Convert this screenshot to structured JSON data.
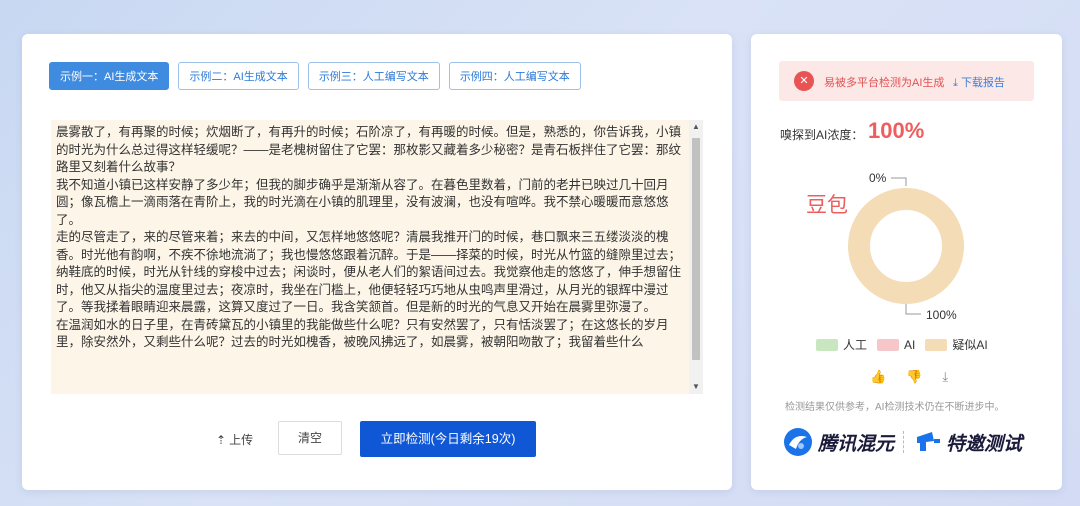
{
  "tabs": [
    {
      "label": "示例一：AI生成文本",
      "active": true
    },
    {
      "label": "示例二：AI生成文本",
      "active": false
    },
    {
      "label": "示例三：人工编写文本",
      "active": false
    },
    {
      "label": "示例四：人工编写文本",
      "active": false
    }
  ],
  "text_paragraphs": [
    "晨雾散了，有再聚的时候；炊烟断了，有再升的时候；石阶凉了，有再暖的时候。但是，熟悉的，你告诉我，小镇的时光为什么总过得这样轻缓呢？——是老槐树留住了它罢：那枚影又藏着多少秘密？是青石板拌住了它罢：那纹路里又刻着什么故事？",
    "我不知道小镇已这样安静了多少年；但我的脚步确乎是渐渐从容了。在暮色里数着，门前的老井已映过几十回月圆；像瓦檐上一滴雨落在青阶上，我的时光滴在小镇的肌理里，没有波澜，也没有喧哗。我不禁心暖暖而意悠悠了。",
    "走的尽管走了，来的尽管来着；来去的中间，又怎样地悠悠呢？清晨我推开门的时候，巷口飘来三五缕淡淡的槐香。时光他有韵啊，不疾不徐地流淌了；我也慢悠悠跟着沉醉。于是——择菜的时候，时光从竹篮的缝隙里过去；纳鞋底的时候，时光从针线的穿梭中过去；闲谈时，便从老人们的絮语间过去。我觉察他走的悠悠了，伸手想留住时，他又从指尖的温度里过去；夜凉时，我坐在门槛上，他便轻轻巧巧地从虫鸣声里滑过，从月光的银辉中漫过了。等我揉着眼睛迎来晨露，这算又度过了一日。我含笑颔首。但是新的时光的气息又开始在晨雾里弥漫了。",
    "在温润如水的日子里，在青砖黛瓦的小镇里的我能做些什么呢？只有安然罢了，只有恬淡罢了；在这悠长的岁月里，除安然外，又剩些什么呢？过去的时光如槐香，被晚风拂远了，如晨雾，被朝阳吻散了；我留着些什么"
  ],
  "buttons": {
    "upload": "上传",
    "clear": "清空",
    "detect": "立即检测(今日剩余19次)"
  },
  "result": {
    "alert": "易被多平台检测为AI生成",
    "download": "下载报告",
    "concentration_label": "嗅探到AI浓度：",
    "concentration_value": "100%",
    "model_label": "豆包",
    "chart_label_top": "0%",
    "chart_label_bottom": "100%",
    "disclaimer": "检测结果仅供参考，AI检测技术仍在不断进步中。"
  },
  "legend": [
    {
      "label": "人工",
      "color": "#c8e6c0"
    },
    {
      "label": "AI",
      "color": "#f7c6c9"
    },
    {
      "label": "疑似AI",
      "color": "#f3dcb6"
    }
  ],
  "chart_data": {
    "type": "pie",
    "categories": [
      "人工",
      "AI",
      "疑似AI"
    ],
    "values": [
      0,
      0,
      100
    ],
    "colors": [
      "#c8e6c0",
      "#f7c6c9",
      "#f3dcb6"
    ]
  },
  "brands": {
    "brand1": "腾讯混元",
    "brand2": "特邀测试"
  },
  "colors": {
    "primary": "#1057d6",
    "tab_active": "#3f8be0",
    "alert": "#e85454",
    "concentration": "#ee5e5e"
  }
}
